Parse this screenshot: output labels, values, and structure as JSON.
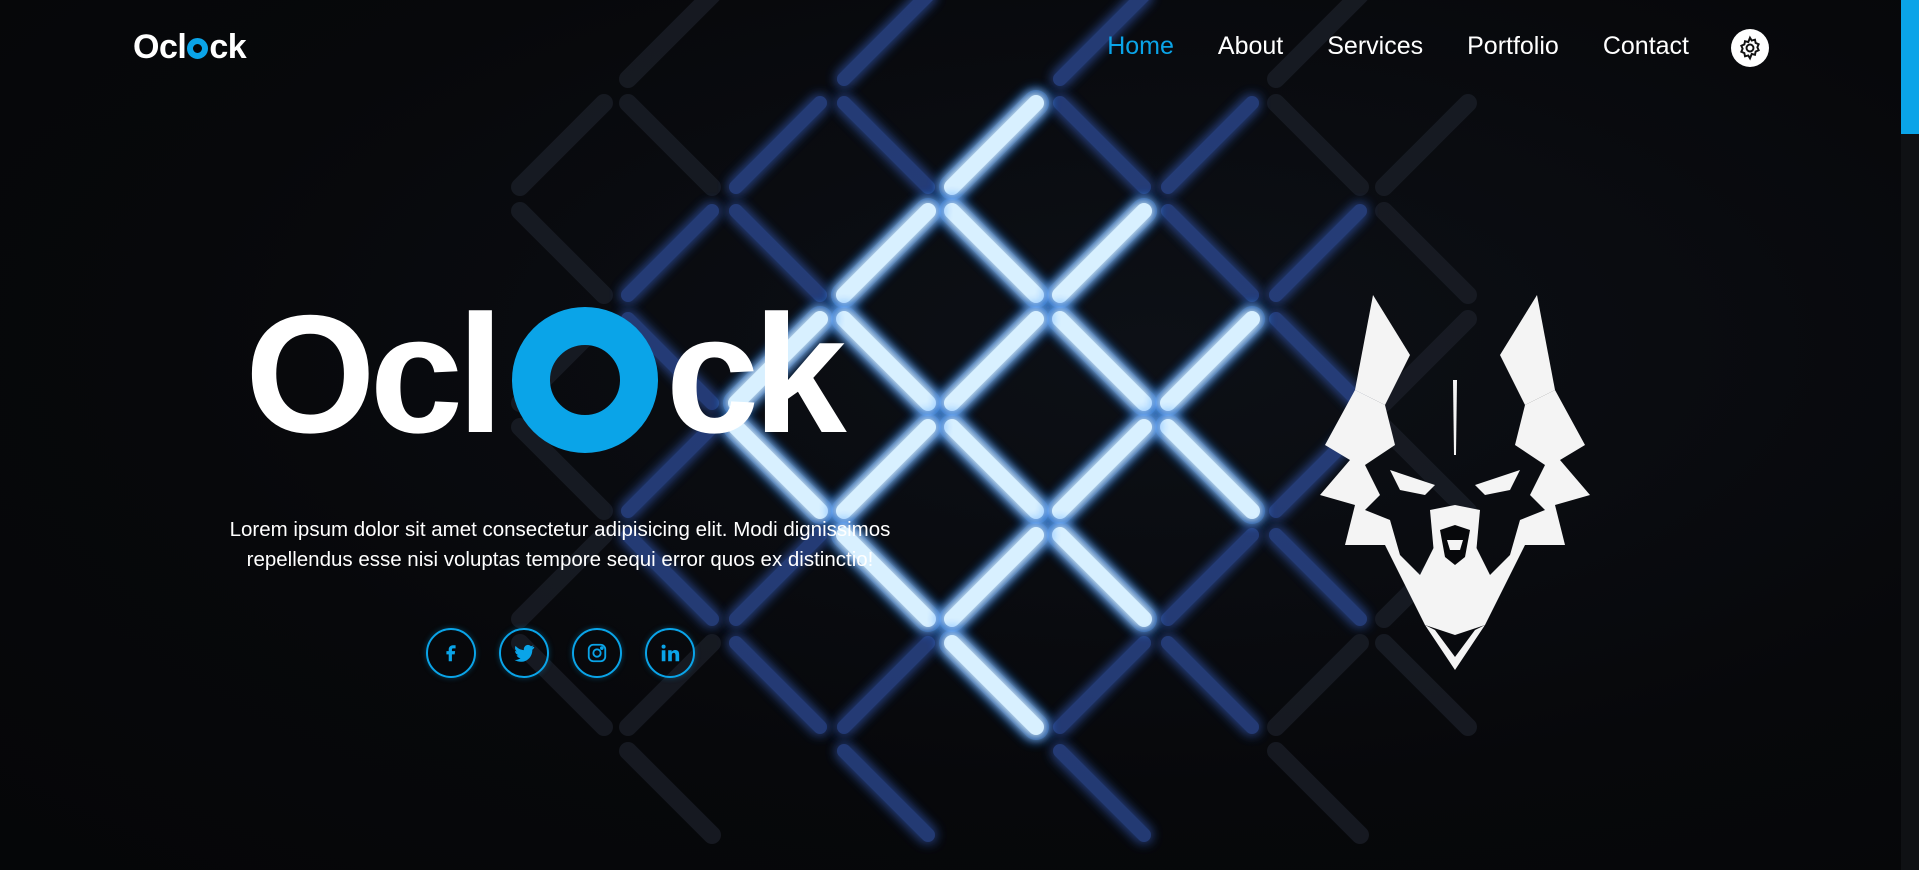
{
  "brand": {
    "logo_prefix": "Ocl",
    "logo_suffix": "ck",
    "accent_color": "#0aa4e8"
  },
  "nav": {
    "items": [
      {
        "label": "Home",
        "active": true
      },
      {
        "label": "About",
        "active": false
      },
      {
        "label": "Services",
        "active": false
      },
      {
        "label": "Portfolio",
        "active": false
      },
      {
        "label": "Contact",
        "active": false
      }
    ],
    "theme_toggle_icon": "gear-icon"
  },
  "hero": {
    "title_prefix": "Ocl",
    "title_suffix": "ck",
    "description": "Lorem ipsum dolor sit amet consectetur adipisicing elit. Modi dignissimos repellendus esse nisi voluptas tempore sequi error quos ex distinctio!",
    "socials": [
      {
        "icon": "facebook-icon",
        "glyph": "f"
      },
      {
        "icon": "twitter-icon",
        "glyph": ""
      },
      {
        "icon": "instagram-icon",
        "glyph": ""
      },
      {
        "icon": "linkedin-icon",
        "glyph": "in"
      }
    ],
    "image": "wolf-head-logo"
  }
}
